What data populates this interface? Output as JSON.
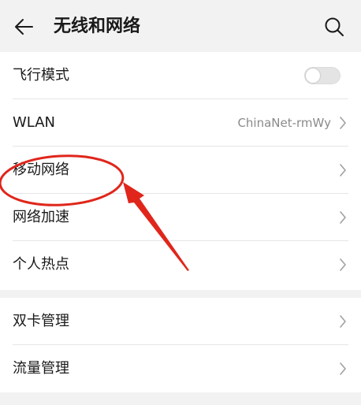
{
  "header": {
    "title": "无线和网络",
    "back_icon": "arrow-left-icon",
    "search_icon": "search-icon"
  },
  "group1": {
    "items": [
      {
        "label": "飞行模式",
        "control": "toggle",
        "toggle_on": false
      },
      {
        "label": "WLAN",
        "value": "ChinaNet-rmWy"
      },
      {
        "label": "移动网络"
      },
      {
        "label": "网络加速"
      },
      {
        "label": "个人热点"
      }
    ]
  },
  "group2": {
    "items": [
      {
        "label": "双卡管理"
      },
      {
        "label": "流量管理"
      }
    ]
  },
  "colors": {
    "annotation": "#e0261b",
    "background": "#f2f2f2",
    "row_background": "#ffffff",
    "secondary_text": "#8a8a8a"
  }
}
